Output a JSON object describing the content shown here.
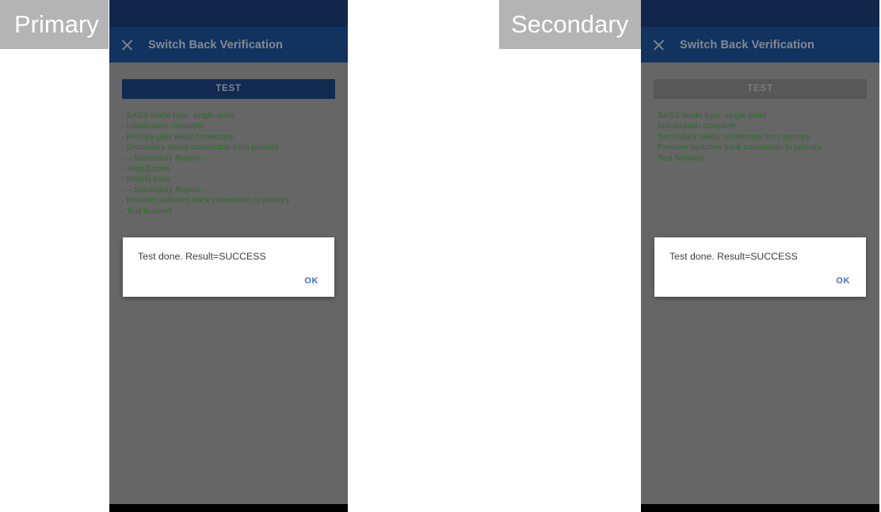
{
  "labels": {
    "primary": "Primary",
    "secondary": "Secondary"
  },
  "colors": {
    "status_bar": "#10264a",
    "app_bar": "#123260",
    "body": "#666666",
    "log_text": "#2f6b2c",
    "button_enabled": "#102a52",
    "button_disabled": "#585858",
    "dialog_action": "#3f6fd0",
    "caption_bg": "#b4b4b4",
    "nav_bar": "#000000"
  },
  "panels": [
    {
      "id": "primary",
      "caption": "Primary",
      "app_bar": {
        "close_icon": "close-icon",
        "title": "Switch Back Verification"
      },
      "test_button": {
        "label": "TEST",
        "state": "enabled"
      },
      "log_lines": [
        "- SASS mode type: single-point",
        "- Initialization complete",
        "- Primary gets initial connection",
        "- Secondary steals connection from primary",
        "- -- Secondary Report --",
        "- step[3] pass",
        "- step[4] pass",
        "- -- Secondary Report --",
        "- Provider switches back connection to primary",
        "- Test finished"
      ],
      "dialog": {
        "message": "Test done. Result=SUCCESS",
        "ok_label": "OK"
      }
    },
    {
      "id": "secondary",
      "caption": "Secondary",
      "app_bar": {
        "close_icon": "close-icon",
        "title": "Switch Back Verification"
      },
      "test_button": {
        "label": "TEST",
        "state": "disabled"
      },
      "log_lines": [
        "- SASS mode type: single-point",
        "- Initialization complete",
        "- Secondary steals connection from primary",
        "- Provider switches back connection to primary",
        "- Test finished"
      ],
      "dialog": {
        "message": "Test done. Result=SUCCESS",
        "ok_label": "OK"
      }
    }
  ]
}
